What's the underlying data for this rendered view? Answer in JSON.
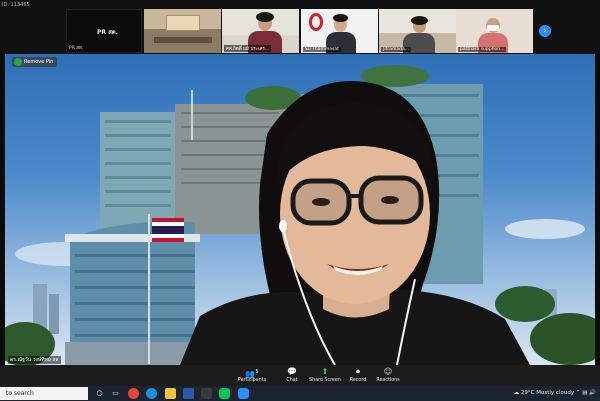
{
  "meeting": {
    "id_label": "ID: 113465"
  },
  "strip": {
    "pr_name": "PR สด.",
    "pr_caption": "PR สด.",
    "thumbnails": [
      {
        "caption": ""
      },
      {
        "caption": "ศศ.กิตติ์ แม้ ประเสร..."
      },
      {
        "caption": "Su Thammasat"
      },
      {
        "caption": "Jitramada..."
      },
      {
        "caption": "patthara supphon..."
      }
    ],
    "next_icon": "chevron-right-icon"
  },
  "main": {
    "remove_pin_label": "Remove Pin",
    "speaker_name": "ดร.ณัฐวัน วงษ์ทิพย์ สส"
  },
  "toolbar": {
    "participants_label": "Participants",
    "participants_count": "5",
    "chat_label": "Chat",
    "share_label": "Share Screen",
    "record_label": "Record",
    "reactions_label": "Reactions"
  },
  "taskbar": {
    "search_placeholder": "to search",
    "temperature": "29°C",
    "weather": "Mostly cloudy"
  },
  "colors": {
    "zoom_blue": "#2d8cff",
    "share_green": "#2ecc51",
    "toolbar_bg": "#1c1c1c"
  }
}
